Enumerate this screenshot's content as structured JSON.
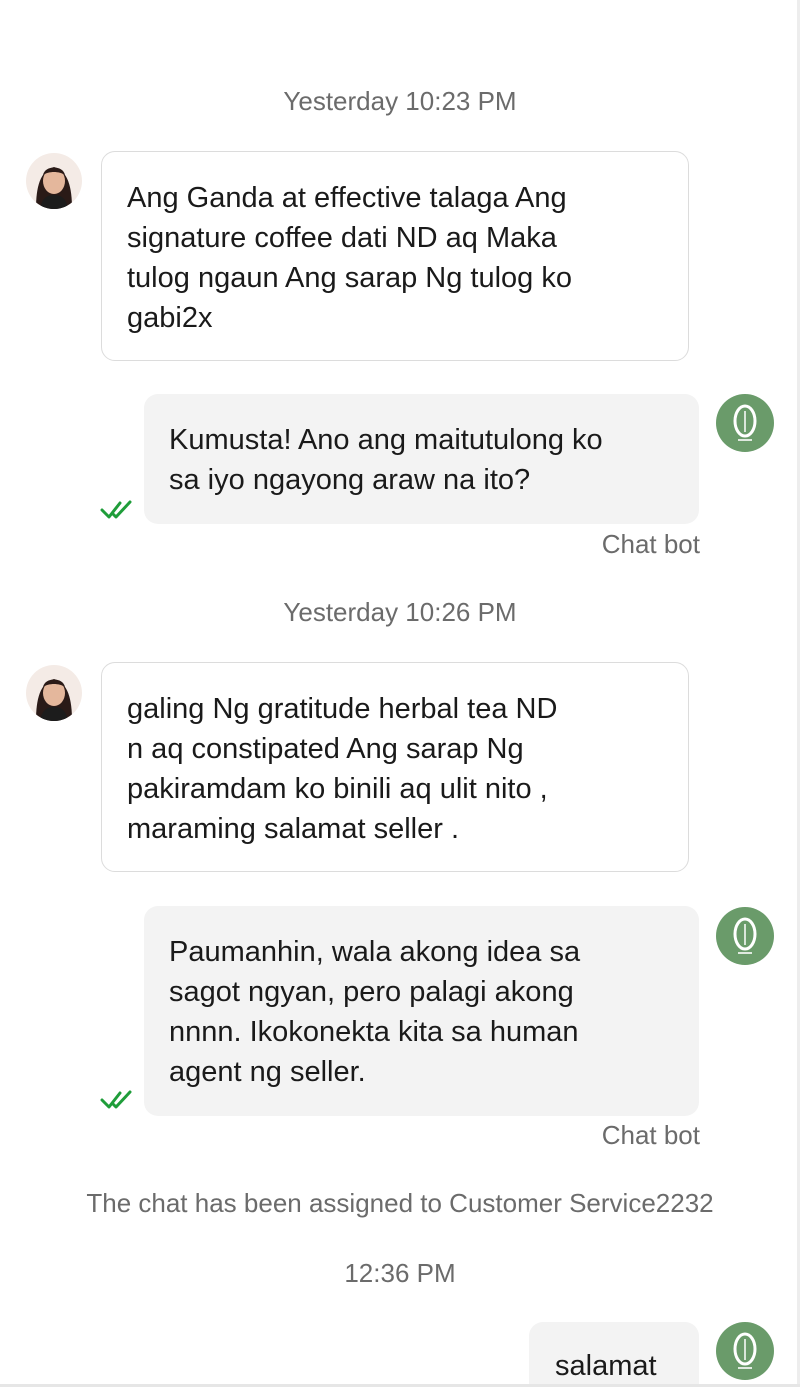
{
  "timestamps": {
    "first": "Yesterday 10:23 PM",
    "second": "Yesterday 10:26 PM",
    "third": "12:36 PM"
  },
  "messages": [
    {
      "side": "customer",
      "text": "Ang Ganda at effective talaga Ang\nsignature coffee dati ND aq Maka\ntulog ngaun Ang sarap Ng tulog ko\ngabi2x"
    },
    {
      "side": "seller",
      "text": "Kumusta! Ano ang maitutulong ko\nsa iyo ngayong araw na ito?",
      "sender": "Chat bot",
      "status_icon": "double-check-icon"
    },
    {
      "side": "customer",
      "text": "galing Ng gratitude herbal tea ND\nn aq constipated Ang sarap Ng\npakiramdam ko binili aq ulit nito ,\nmaraming salamat seller ."
    },
    {
      "side": "seller",
      "text": "Paumanhin, wala akong idea sa\nsagot ngyan, pero palagi akong\nnnnn. Ikokonekta kita sa human\nagent ng seller.",
      "sender": "Chat bot",
      "status_icon": "double-check-icon"
    },
    {
      "side": "seller",
      "text": "salamat"
    }
  ],
  "system_note": "The chat has been assigned to Customer Service2232",
  "colors": {
    "check_green": "#1f9d3a",
    "bot_avatar_green": "#6a9b6a",
    "bubble_out_bg": "#f3f3f3",
    "muted_text": "#6b6b6b"
  }
}
